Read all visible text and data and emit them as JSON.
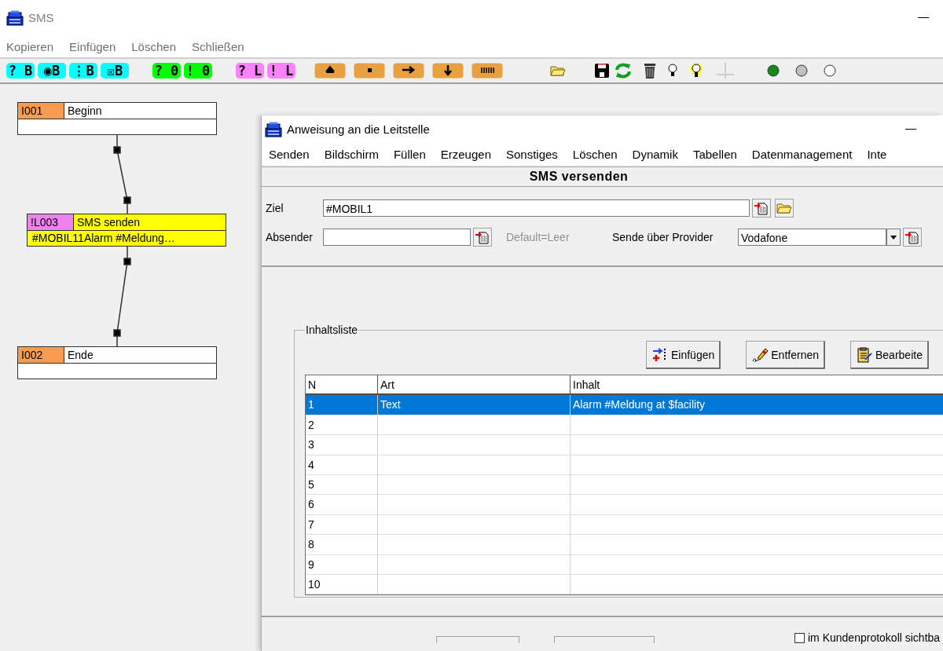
{
  "window": {
    "title": "SMS"
  },
  "menu": [
    "Kopieren",
    "Einfügen",
    "Löschen",
    "Schließen"
  ],
  "toolbar": {
    "mode_buttons": [
      {
        "label": "? B",
        "color": "#00ffff"
      },
      {
        "label": "◉B",
        "color": "#00ffff"
      },
      {
        "label": "⋮B",
        "color": "#00ffff"
      },
      {
        "label": "☒B",
        "color": "#00ffff"
      },
      {
        "label": "? 0",
        "color": "#00ff00"
      },
      {
        "label": "! 0",
        "color": "#00ff00"
      },
      {
        "label": "? L",
        "color": "#ff80ff"
      },
      {
        "label": "! L",
        "color": "#ff80ff"
      }
    ],
    "status_dots": [
      {
        "color": "#138a13"
      },
      {
        "color": "#c0c0c0"
      },
      {
        "color": "#ffffff"
      }
    ]
  },
  "flow": {
    "nodes": [
      {
        "id": "I001",
        "title": "Beginn",
        "kind": "marker",
        "color": "#f89c50"
      },
      {
        "id": "!L003",
        "title": "SMS senden",
        "detail": "#MOBIL11Alarm #Meldung…",
        "kind": "action",
        "color": "#ee82ee"
      },
      {
        "id": "I002",
        "title": "Ende",
        "kind": "marker",
        "color": "#f89c50"
      }
    ]
  },
  "dialog": {
    "title": "Anweisung an die Leitstelle",
    "menu": [
      "Senden",
      "Bildschirm",
      "Füllen",
      "Erzeugen",
      "Sonstiges",
      "Löschen",
      "Dynamik",
      "Tabellen",
      "Datenmanagement",
      "Inte"
    ],
    "heading": "SMS versenden",
    "target": {
      "label": "Ziel",
      "value": "#MOBIL1"
    },
    "sender": {
      "label": "Absender",
      "note": "Default=Leer"
    },
    "provider": {
      "label": "Sende über Provider",
      "value": "Vodafone"
    },
    "content_list": {
      "title": "Inhaltsliste",
      "buttons": [
        "Einfügen",
        "Entfernen",
        "Bearbeite"
      ],
      "columns": [
        "N",
        "Art",
        "Inhalt"
      ],
      "rows": [
        {
          "n": "1",
          "art": "Text",
          "inhalt": "Alarm #Meldung at $facility",
          "selected": true
        },
        {
          "n": "2",
          "selected": false
        },
        {
          "n": "3",
          "selected": false
        },
        {
          "n": "4",
          "selected": false
        },
        {
          "n": "5",
          "selected": false
        },
        {
          "n": "6",
          "selected": false
        },
        {
          "n": "7",
          "selected": false
        },
        {
          "n": "8",
          "selected": false
        },
        {
          "n": "9",
          "selected": false
        },
        {
          "n": "10",
          "selected": false
        }
      ]
    },
    "protocol_checkbox": {
      "label": "im Kundenprotokoll sichtba",
      "checked": false
    }
  }
}
